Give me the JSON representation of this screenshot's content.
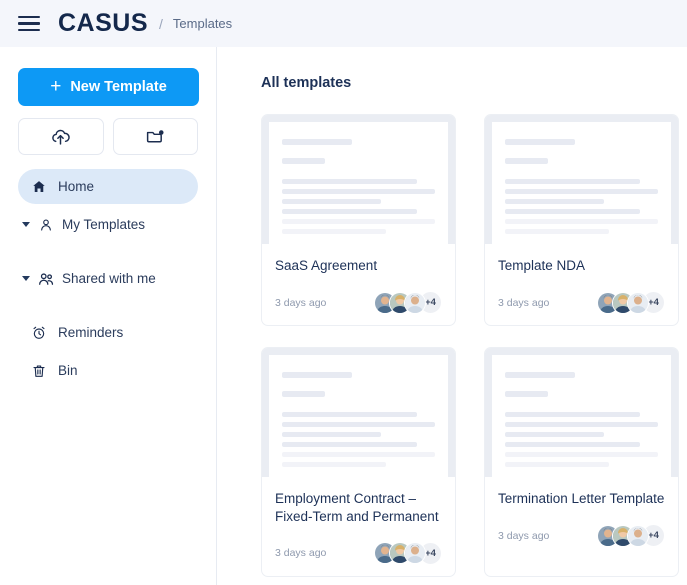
{
  "header": {
    "menu_icon": "hamburger-icon",
    "brand": "CASUS",
    "separator": "/",
    "breadcrumb": "Templates"
  },
  "sidebar": {
    "new_template_label": "New Template",
    "new_template_plus": "+",
    "upload_icon": "upload-cloud-icon",
    "new_folder_icon": "new-folder-icon",
    "items": [
      {
        "label": "Home",
        "icon": "home-icon",
        "active": true,
        "expandable": false
      },
      {
        "label": "My Templates",
        "icon": "user-icon",
        "active": false,
        "expandable": true
      },
      {
        "label": "Shared with me",
        "icon": "users-icon",
        "active": false,
        "expandable": true
      },
      {
        "label": "Reminders",
        "icon": "alarm-clock-icon",
        "active": false,
        "expandable": false
      },
      {
        "label": "Bin",
        "icon": "trash-icon",
        "active": false,
        "expandable": false
      }
    ]
  },
  "main": {
    "section_title": "All templates",
    "cards": [
      {
        "title": "SaaS Agreement",
        "timestamp": "3 days ago",
        "more_count": "+4"
      },
      {
        "title": "Template NDA",
        "timestamp": "3 days ago",
        "more_count": "+4"
      },
      {
        "title": "Employment Contract – Fixed-Term and Permanent",
        "timestamp": "3 days ago",
        "more_count": "+4"
      },
      {
        "title": "Termination Letter Template",
        "timestamp": "3 days ago",
        "more_count": "+4"
      }
    ]
  },
  "colors": {
    "accent": "#0d99f5",
    "active_pill": "#dce9f8",
    "title_navy": "#1d3157",
    "muted": "#8e99ad",
    "preview_frame": "#eaedf3",
    "skeleton": "#e7eaf2"
  }
}
